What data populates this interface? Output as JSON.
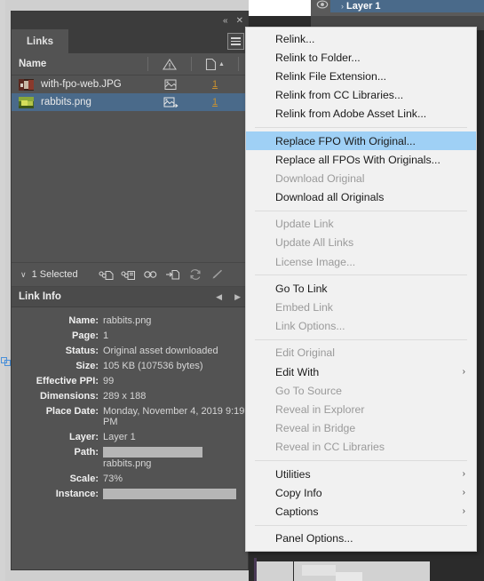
{
  "app": {
    "background_color": "#2b2b2b",
    "panel_bg": "#535353",
    "selection_blue": "#4a6a8a",
    "menu_highlight": "#9fd0f5",
    "link_orange": "#c9912f"
  },
  "layers_panel": {
    "eye_icon": "eye-icon",
    "chevron": "›",
    "layer_name": "Layer 1"
  },
  "links_panel": {
    "titlebar": {
      "collapse_label": "«",
      "close_label": "✕"
    },
    "tab_label": "Links",
    "menu_button_name": "panel-menu-icon",
    "columns": {
      "name": "Name",
      "status_icon": "warning-triangle-icon",
      "page_icon": "page-icon",
      "page_sort": "▲"
    },
    "rows": [
      {
        "name": "with-fpo-web.JPG",
        "status_icon": "fpo-link-icon",
        "page": "1",
        "selected": false,
        "thumb_colors": [
          "#5b2a20",
          "#c8b8a4",
          "#8a3a2c",
          "#3a2018"
        ]
      },
      {
        "name": "rabbits.png",
        "status_icon": "fpo-link-modified-icon",
        "page": "1",
        "selected": true,
        "thumb_colors": [
          "#8aa83a",
          "#d6dd5a",
          "#4c6b22",
          "#b4c64a"
        ]
      }
    ],
    "selection_bar": {
      "caret": "∨",
      "count_label": "1 Selected",
      "icons": [
        "relink-icon",
        "relink-all-icon",
        "go-to-link-icon",
        "update-link-icon",
        "refresh-icon",
        "edit-original-icon"
      ]
    },
    "link_info": {
      "title": "Link Info",
      "prev_arrow": "◀",
      "next_arrow": "▶",
      "fields": [
        {
          "label": "Name:",
          "value": "rabbits.png"
        },
        {
          "label": "Page:",
          "value": "1"
        },
        {
          "label": "Status:",
          "value": "Original asset downloaded"
        },
        {
          "label": "Size:",
          "value": "105 KB (107536 bytes)"
        },
        {
          "label": "Effective PPI:",
          "value": "99"
        },
        {
          "label": "Dimensions:",
          "value": "289 x 188"
        },
        {
          "label": "Place Date:",
          "value": "Monday, November 4, 2019 9:19 PM"
        },
        {
          "label": "Layer:",
          "value": "Layer 1"
        },
        {
          "label": "Path:",
          "value": "rabbits.png",
          "redacted_before": true
        },
        {
          "label": "Scale:",
          "value": "73%"
        },
        {
          "label": "Instance:",
          "value": "",
          "redacted_only": true
        }
      ]
    }
  },
  "context_menu": {
    "items": [
      {
        "label": "Relink...",
        "state": "enabled"
      },
      {
        "label": "Relink to Folder...",
        "state": "enabled"
      },
      {
        "label": "Relink File Extension...",
        "state": "enabled"
      },
      {
        "label": "Relink from CC Libraries...",
        "state": "enabled"
      },
      {
        "label": "Relink from Adobe Asset Link...",
        "state": "enabled"
      },
      {
        "separator": true
      },
      {
        "label": "Replace FPO With Original...",
        "state": "highlighted"
      },
      {
        "label": "Replace all FPOs With Originals...",
        "state": "enabled"
      },
      {
        "label": "Download Original",
        "state": "disabled"
      },
      {
        "label": "Download all Originals",
        "state": "enabled"
      },
      {
        "separator": true
      },
      {
        "label": "Update Link",
        "state": "disabled"
      },
      {
        "label": "Update All Links",
        "state": "disabled"
      },
      {
        "label": "License Image...",
        "state": "disabled"
      },
      {
        "separator": true
      },
      {
        "label": "Go To Link",
        "state": "enabled"
      },
      {
        "label": "Embed Link",
        "state": "disabled"
      },
      {
        "label": "Link Options...",
        "state": "disabled"
      },
      {
        "separator": true
      },
      {
        "label": "Edit Original",
        "state": "disabled"
      },
      {
        "label": "Edit With",
        "state": "enabled",
        "submenu": "›"
      },
      {
        "label": "Go To Source",
        "state": "disabled"
      },
      {
        "label": "Reveal in Explorer",
        "state": "disabled"
      },
      {
        "label": "Reveal in Bridge",
        "state": "disabled"
      },
      {
        "label": "Reveal in CC Libraries",
        "state": "disabled"
      },
      {
        "separator": true
      },
      {
        "label": "Utilities",
        "state": "enabled",
        "submenu": "›"
      },
      {
        "label": "Copy Info",
        "state": "enabled",
        "submenu": "›"
      },
      {
        "label": "Captions",
        "state": "enabled",
        "submenu": "›"
      },
      {
        "separator": true
      },
      {
        "label": "Panel Options...",
        "state": "enabled"
      }
    ]
  }
}
